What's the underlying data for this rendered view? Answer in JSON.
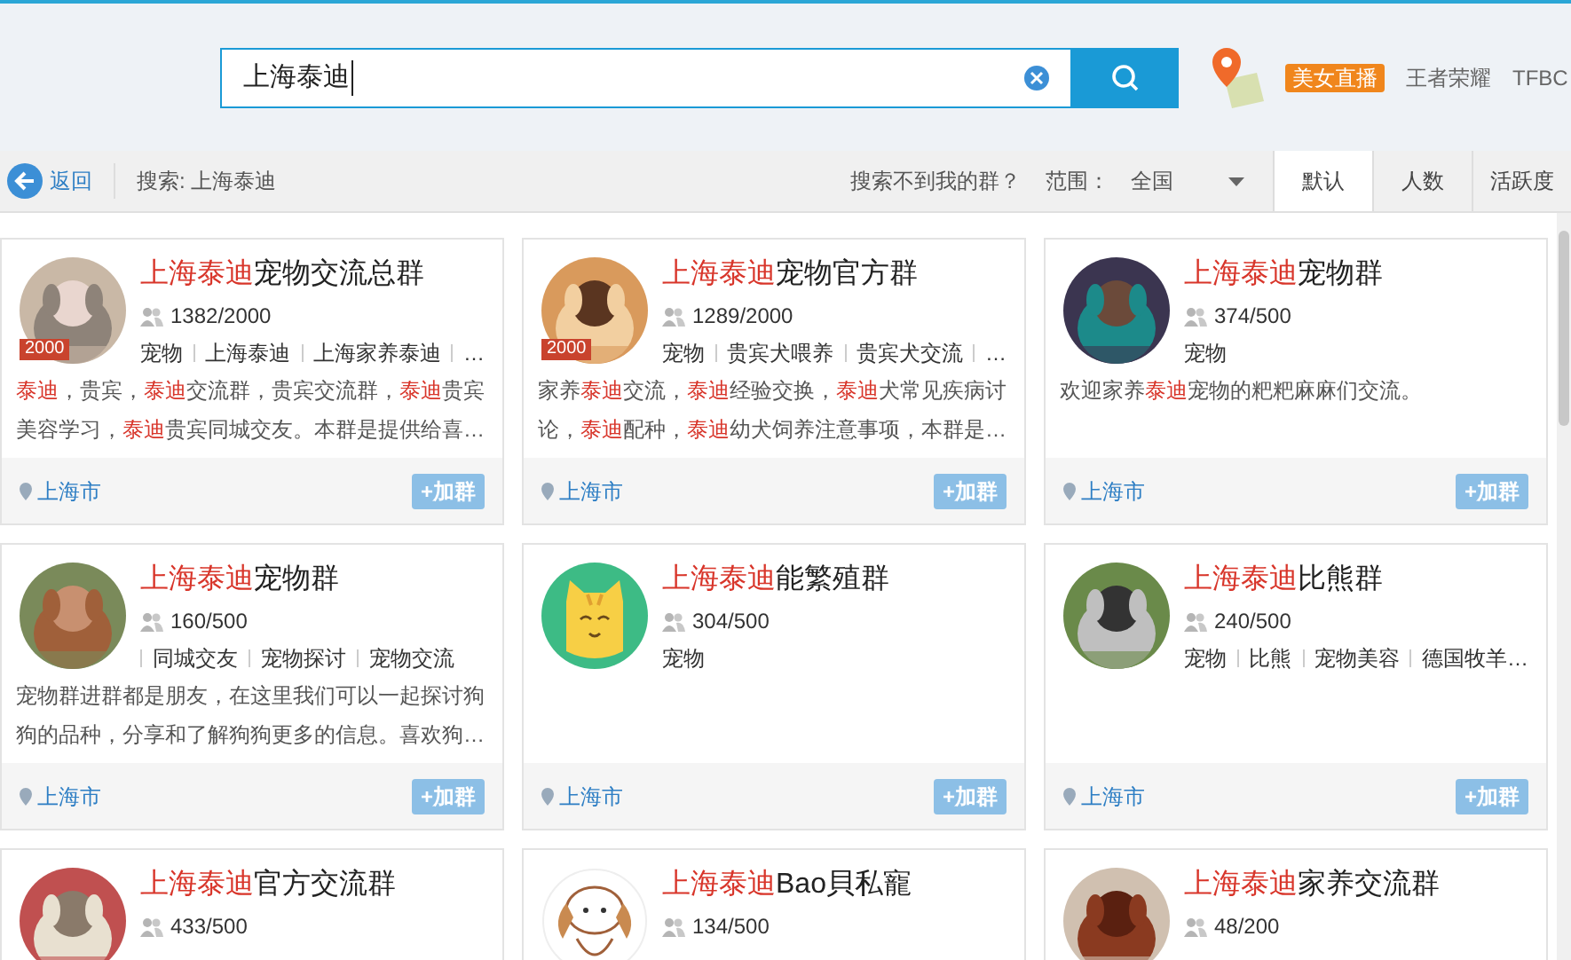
{
  "search": {
    "value": "上海泰迪"
  },
  "header_links": [
    {
      "label": "美女直播",
      "kind": "badge"
    },
    {
      "label": "王者荣耀",
      "kind": "link"
    },
    {
      "label": "TFBC",
      "kind": "link"
    }
  ],
  "toolbar": {
    "back": "返回",
    "query": "搜索: 上海泰迪",
    "help": "搜索不到我的群？",
    "range_label": "范围：",
    "range_value": "全国"
  },
  "sort_tabs": [
    {
      "label": "默认",
      "selected": true
    },
    {
      "label": "人数",
      "selected": false
    },
    {
      "label": "活跃度",
      "selected": false
    }
  ],
  "cards": [
    {
      "avatar": {
        "kind": "picture"
      },
      "badge": "2000",
      "highlight": "上海泰迪",
      "name": "宠物交流总群",
      "members": "1382/2000",
      "tags_leading_bar": false,
      "tags": [
        "宠物",
        "上海泰迪",
        "上海家养泰迪",
        "…"
      ],
      "description": [
        {
          "text": "泰迪",
          "highlight": true
        },
        {
          "text": "，贵宾，",
          "highlight": false
        },
        {
          "text": "泰迪",
          "highlight": true
        },
        {
          "text": "交流群，贵宾交流群，",
          "highlight": false
        },
        {
          "text": "泰迪",
          "highlight": true
        },
        {
          "text": "贵宾美容学习，",
          "highlight": false
        },
        {
          "text": "泰迪",
          "highlight": true
        },
        {
          "text": "贵宾同城交友。本群是提供给喜…",
          "highlight": false
        }
      ],
      "location": "上海市",
      "join": "+加群"
    },
    {
      "avatar": {
        "kind": "picture"
      },
      "badge": "2000",
      "highlight": "上海泰迪",
      "name": "宠物官方群",
      "members": "1289/2000",
      "tags_leading_bar": false,
      "tags": [
        "宠物",
        "贵宾犬喂养",
        "贵宾犬交流",
        "…"
      ],
      "description": [
        {
          "text": "家养",
          "highlight": false
        },
        {
          "text": "泰迪",
          "highlight": true
        },
        {
          "text": "交流，",
          "highlight": false
        },
        {
          "text": "泰迪",
          "highlight": true
        },
        {
          "text": "经验交换，",
          "highlight": false
        },
        {
          "text": "泰迪",
          "highlight": true
        },
        {
          "text": "犬常见疾病讨论，",
          "highlight": false
        },
        {
          "text": "泰迪",
          "highlight": true
        },
        {
          "text": "配种，",
          "highlight": false
        },
        {
          "text": "泰迪",
          "highlight": true
        },
        {
          "text": "幼犬饲养注意事项，本群是…",
          "highlight": false
        }
      ],
      "location": "上海市",
      "join": "+加群"
    },
    {
      "avatar": {
        "kind": "picture"
      },
      "highlight": "上海泰迪",
      "name": "宠物群",
      "members": "374/500",
      "tags_leading_bar": false,
      "tags": [
        "宠物"
      ],
      "description": [
        {
          "text": "欢迎家养",
          "highlight": false
        },
        {
          "text": "泰迪",
          "highlight": true
        },
        {
          "text": "宠物的粑粑麻麻们交流。",
          "highlight": false
        }
      ],
      "location": "上海市",
      "join": "+加群"
    },
    {
      "avatar": {
        "kind": "picture"
      },
      "highlight": "上海泰迪",
      "name": "宠物群",
      "members": "160/500",
      "tags_leading_bar": true,
      "tags": [
        "同城交友",
        "宠物探讨",
        "宠物交流"
      ],
      "description": [
        {
          "text": "宠物群进群都是朋友，在这里我们可以一起探讨狗狗的品种，分享和了解狗狗更多的信息。喜欢狗…",
          "highlight": false
        }
      ],
      "location": "上海市",
      "join": "+加群"
    },
    {
      "avatar": {
        "kind": "cat"
      },
      "highlight": "上海泰迪",
      "name": "能繁殖群",
      "members": "304/500",
      "tags_leading_bar": false,
      "tags": [
        "宠物"
      ],
      "location": "上海市",
      "join": "+加群"
    },
    {
      "avatar": {
        "kind": "picture"
      },
      "highlight": "上海泰迪",
      "name": "比熊群",
      "members": "240/500",
      "tags_leading_bar": false,
      "tags": [
        "宠物",
        "比熊",
        "宠物美容",
        "德国牧羊…"
      ],
      "location": "上海市",
      "join": "+加群"
    },
    {
      "avatar": {
        "kind": "picture"
      },
      "highlight": "上海泰迪",
      "name": "官方交流群",
      "members": "433/500"
    },
    {
      "avatar": {
        "kind": "cartoon-dog"
      },
      "highlight": "上海泰迪",
      "name": "Bao貝私寵",
      "members": "134/500"
    },
    {
      "avatar": {
        "kind": "picture"
      },
      "highlight": "上海泰迪",
      "name": "家养交流群",
      "members": "48/200"
    }
  ]
}
